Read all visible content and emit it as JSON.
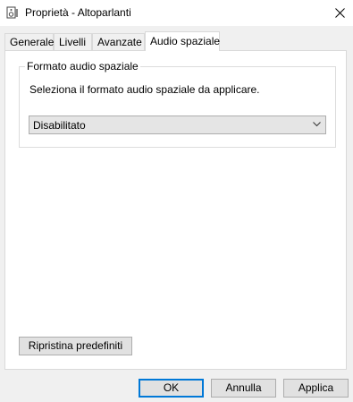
{
  "window": {
    "title": "Proprietà - Altoparlanti",
    "icon": "speaker-icon",
    "close_icon": "close-icon"
  },
  "tabs": [
    {
      "label": "Generale",
      "active": false
    },
    {
      "label": "Livelli",
      "active": false
    },
    {
      "label": "Avanzate",
      "active": false
    },
    {
      "label": "Audio spaziale",
      "active": true
    }
  ],
  "spatial": {
    "group_title": "Formato audio spaziale",
    "description": "Seleziona il formato audio spaziale da applicare.",
    "format_select": {
      "value": "Disabilitato"
    }
  },
  "buttons": {
    "restore_defaults": "Ripristina predefiniti",
    "ok": "OK",
    "cancel": "Annulla",
    "apply": "Applica"
  },
  "colors": {
    "accent": "#0078d7"
  }
}
